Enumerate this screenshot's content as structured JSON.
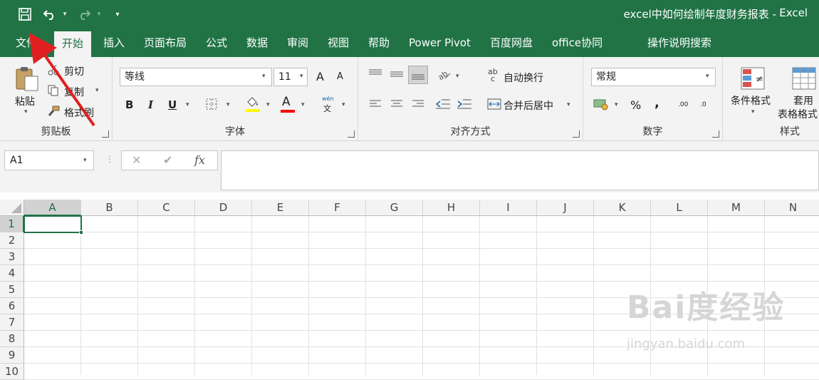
{
  "title": "excel中如何绘制年度财务报表",
  "title_separator": "-",
  "app_name": "Excel",
  "tabs": [
    "文件",
    "开始",
    "插入",
    "页面布局",
    "公式",
    "数据",
    "审阅",
    "视图",
    "帮助",
    "Power Pivot",
    "百度网盘",
    "office协同",
    "操作说明搜索"
  ],
  "clipboard": {
    "paste": "粘贴",
    "cut": "剪切",
    "copy": "复制",
    "format_painter": "格式刷",
    "group": "剪贴板"
  },
  "font": {
    "name": "等线",
    "size": "11",
    "bold": "B",
    "italic": "I",
    "underline": "U",
    "group": "字体",
    "phonetic_top": "wén",
    "phonetic_bottom": "文",
    "grow": "A",
    "shrink": "A",
    "color_letter": "A",
    "fill_color": "#FFFF00",
    "font_color": "#FF0000"
  },
  "alignment": {
    "wrap": "自动换行",
    "merge": "合并后居中",
    "group": "对齐方式",
    "ab": "ab",
    "c": "c"
  },
  "number": {
    "format": "常规",
    "group": "数字",
    "percent": "%",
    "comma": ",",
    "inc_dec": ".00",
    "inc_dec2": ".0"
  },
  "styles": {
    "conditional": "条件格式",
    "table_line1": "套用",
    "table_line2": "表格格式",
    "group": "样式"
  },
  "formula_bar": {
    "name_box": "A1",
    "cancel": "✕",
    "enter": "✔",
    "fx": "fx"
  },
  "columns": [
    "A",
    "B",
    "C",
    "D",
    "E",
    "F",
    "G",
    "H",
    "I",
    "J",
    "K",
    "L",
    "M",
    "N"
  ],
  "rows": [
    "1",
    "2",
    "3",
    "4",
    "5",
    "6",
    "7",
    "8",
    "9",
    "10"
  ],
  "watermark": {
    "text": "Bai度经验",
    "sub": "jingyan.baidu.com"
  },
  "colors": {
    "accent": "#217346",
    "arrow": "#E02020"
  }
}
